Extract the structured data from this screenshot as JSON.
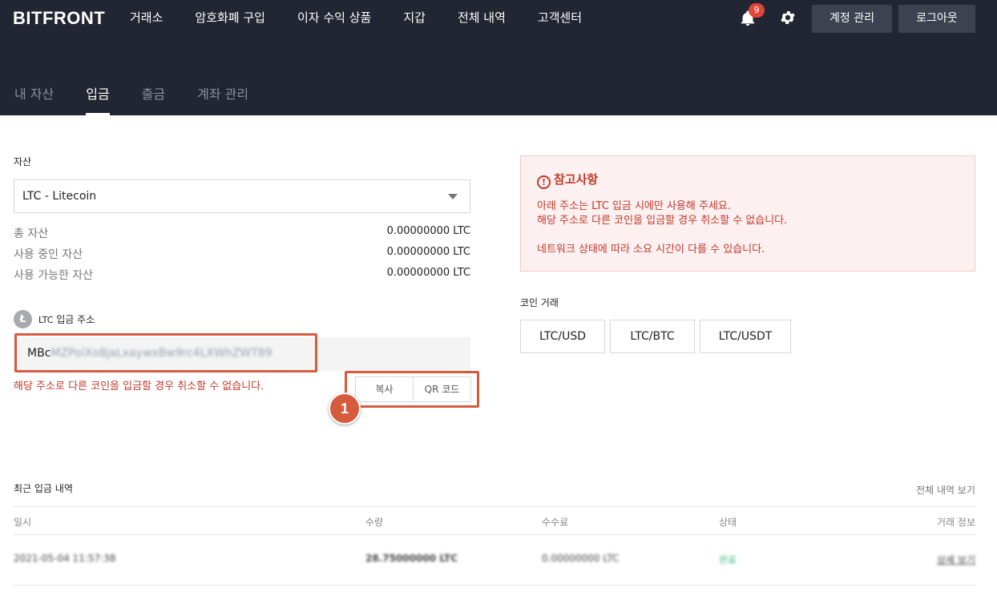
{
  "header": {
    "logo": "BITFRONT",
    "nav": [
      "거래소",
      "암호화폐 구입",
      "이자 수익 상품",
      "지갑",
      "전체 내역",
      "고객센터"
    ],
    "notification_count": "9",
    "account_button": "계정 관리",
    "logout_button": "로그아웃"
  },
  "subnav": {
    "tabs": [
      "내 자산",
      "입금",
      "출금",
      "계좌 관리"
    ],
    "active": "입금"
  },
  "asset": {
    "label": "자산",
    "selected": "LTC - Litecoin",
    "balances": [
      {
        "label": "총 자산",
        "value": "0.00000000 LTC"
      },
      {
        "label": "사용 중인 자산",
        "value": "0.00000000 LTC"
      },
      {
        "label": "사용 가능한 자산",
        "value": "0.00000000 LTC"
      }
    ]
  },
  "deposit": {
    "coin_prefix": "LTC",
    "address_label": "입금 주소",
    "coin_icon_letter": "Ł",
    "address_visible": "MBc",
    "address_blurred": "MZPoiXo8jaLxaywxBw9rc4LXWhZWT89",
    "warning": "해당 주소로 다른 코인을 입금할 경우 취소할 수 없습니다.",
    "copy_button": "복사",
    "qr_button": "QR 코드",
    "step_number": "1"
  },
  "notice": {
    "icon": "!",
    "title": "참고사항",
    "line1": "아래 주소는 LTC 입금 시에만 사용해 주세요.",
    "line2": "해당 주소로 다른 코인을 입금할 경우 취소할 수 없습니다.",
    "line3": "네트워크 상태에 따라 소요 시간이 다를 수 있습니다."
  },
  "pairs": {
    "label": "코인 거래",
    "items": [
      "LTC/USD",
      "LTC/BTC",
      "LTC/USDT"
    ]
  },
  "history": {
    "title": "최근 입금 내역",
    "view_all": "전체 내역 보기",
    "columns": [
      "일시",
      "수량",
      "수수료",
      "상태",
      "거래 정보"
    ],
    "rows": [
      {
        "date": "2021-05-04 11:57:38",
        "amount": "28.75000000 LTC",
        "fee": "0.00000000 LTC",
        "status": "완료",
        "info": "상세 보기"
      }
    ]
  },
  "colors": {
    "header_bg": "#222632",
    "highlight": "#d65b3d",
    "warning": "#c0392b",
    "status_done": "#3cb88a"
  }
}
